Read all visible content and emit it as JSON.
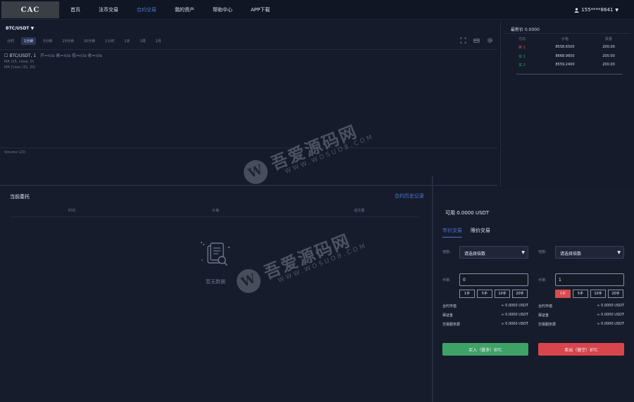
{
  "header": {
    "logo_text": "CAC",
    "nav": [
      {
        "label": "首页",
        "active": false
      },
      {
        "label": "法币交易",
        "active": false
      },
      {
        "label": "合约交易",
        "active": true
      },
      {
        "label": "我的资产",
        "active": false
      },
      {
        "label": "帮助中心",
        "active": false
      },
      {
        "label": "APP下载",
        "active": false
      }
    ],
    "user": "155****8641"
  },
  "chart": {
    "pair": "BTC/USDT",
    "intervals": [
      "分时",
      "1分钟",
      "5分钟",
      "15分钟",
      "30分钟",
      "1小时",
      "1天",
      "1周",
      "1月"
    ],
    "active_interval": 1,
    "legend_title": "BTC/USDT, 1",
    "legend_ohlc": "开=n/a 高=n/a 低=n/a 收=n/a",
    "ma_line": "MA (15, close, 0)",
    "macross_line": "MA Cross (15, 20)",
    "volume_label": "Volume (20)"
  },
  "orderbook": {
    "title": "最新价 0.0000",
    "headers": [
      "方向",
      "价格",
      "数量"
    ],
    "sells": [
      {
        "side": "卖 1",
        "price": "8558.6500",
        "qty": "200.00"
      }
    ],
    "buys": [
      {
        "side": "买 1",
        "price": "8668.9600",
        "qty": "200.00"
      },
      {
        "side": "买 2",
        "price": "8559.2400",
        "qty": "200.00"
      }
    ]
  },
  "orders": {
    "title": "当前委托",
    "link": "合约历史记录",
    "headers": [
      "时间",
      "价格",
      "成交量"
    ],
    "empty_text": "暂无数据"
  },
  "trade": {
    "available": "可用 0.0000 USDT",
    "tabs": [
      {
        "label": "市价交易",
        "active": true
      },
      {
        "label": "限价交易",
        "active": false
      }
    ],
    "left": {
      "leverage_label": "倍数:",
      "leverage_value": "请选择倍数",
      "hands_label": "手数:",
      "hands_value": "0",
      "lots": [
        "1手",
        "5手",
        "10手",
        "20手"
      ],
      "lot_active": -1,
      "info": [
        {
          "label": "合约市值",
          "value": "≈ 0.0000 USDT"
        },
        {
          "label": "保证金",
          "value": "≈ 0.0000 USDT"
        },
        {
          "label": "交易服务费",
          "value": "≈ 0.0000 USDT"
        }
      ],
      "button": "买入（做多）BTC"
    },
    "right": {
      "leverage_label": "倍数:",
      "leverage_value": "请选择倍数",
      "hands_label": "手数:",
      "hands_value": "1",
      "lots": [
        "1手",
        "5手",
        "10手",
        "20手"
      ],
      "lot_active": 0,
      "info": [
        {
          "label": "合约市值",
          "value": "≈ 0.0000 USDT"
        },
        {
          "label": "保证金",
          "value": "≈ 0.0000 USDT"
        },
        {
          "label": "交易服务费",
          "value": "≈ 0.0000 USDT"
        }
      ],
      "button": "卖出（做空）BTC"
    }
  },
  "watermark": {
    "cn": "吾爱源码网",
    "en": "WWW.WOSUO8.COM",
    "letter": "W"
  },
  "colors": {
    "accent": "#4c78d6",
    "buy": "#3ea266",
    "sell": "#d8454c",
    "background": "#141a29"
  }
}
